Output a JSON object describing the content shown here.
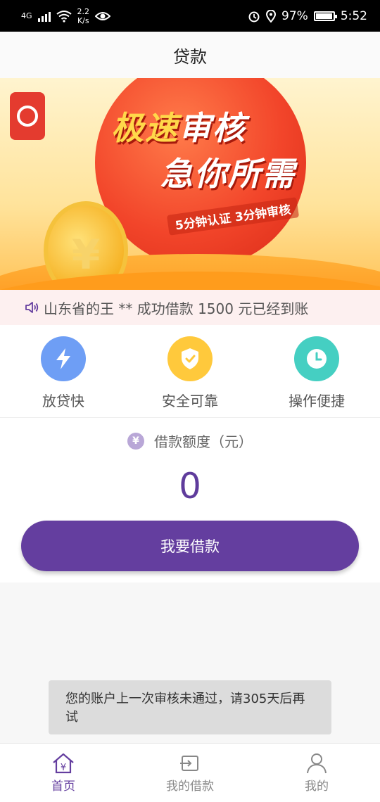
{
  "status_bar": {
    "network": "4G",
    "speed_value": "2.2",
    "speed_unit": "K/s",
    "battery": "97%",
    "time": "5:52"
  },
  "header": {
    "title": "贷款"
  },
  "banner": {
    "line1_a": "极速",
    "line1_b": "审核",
    "line2": "急你所需",
    "line3": "5分钟认证 3分钟审核"
  },
  "notice": {
    "text": "山东省的王 ** 成功借款 1500 元已经到账"
  },
  "features": [
    {
      "label": "放贷快",
      "icon": "lightning-icon",
      "color": "#6e9ef5"
    },
    {
      "label": "安全可靠",
      "icon": "shield-check-icon",
      "color": "#ffc93c"
    },
    {
      "label": "操作便捷",
      "icon": "clock-icon",
      "color": "#45cfc2"
    }
  ],
  "amount": {
    "label": "借款额度（元）",
    "icon": "yen-icon",
    "value": "0"
  },
  "borrow_button": {
    "label": "我要借款",
    "color": "#643e9f"
  },
  "toast": {
    "text": "您的账户上一次审核未通过，请305天后再试"
  },
  "bottom_nav": {
    "items": [
      {
        "label": "首页",
        "icon": "home-icon",
        "active": true
      },
      {
        "label": "我的借款",
        "icon": "loan-record-icon",
        "active": false
      },
      {
        "label": "我的",
        "icon": "user-icon",
        "active": false
      }
    ]
  }
}
